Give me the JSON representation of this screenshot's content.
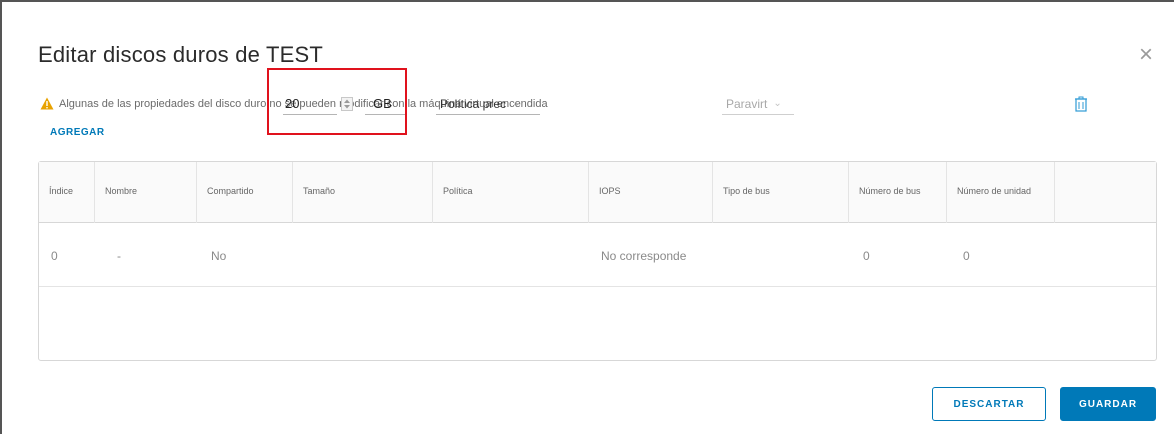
{
  "dialog": {
    "title": "Editar discos duros de TEST",
    "close_symbol": "×",
    "warning_text": "Algunas de las propiedades del disco duro no se pueden modificar con la máquina virtual encendida",
    "warning_icon": "warning-triangle-icon",
    "add_label": "AGREGAR"
  },
  "grid": {
    "columns": [
      "Índice",
      "Nombre",
      "Compartido",
      "Tamaño",
      "Política",
      "IOPS",
      "Tipo de bus",
      "Número de bus",
      "Número de unidad",
      ""
    ],
    "rows": [
      {
        "index": "0",
        "name": "-",
        "shared": "No",
        "size_value": "20",
        "size_unit": "GB",
        "policy": "Política prec",
        "iops": "No corresponde",
        "bus_type": "Paravirt",
        "bus_number": "0",
        "unit_number": "0"
      }
    ]
  },
  "footer": {
    "discard_label": "DESCARTAR",
    "save_label": "GUARDAR"
  },
  "colors": {
    "accent": "#0079b8",
    "warning": "#e8a200",
    "highlight": "#e0121d"
  }
}
